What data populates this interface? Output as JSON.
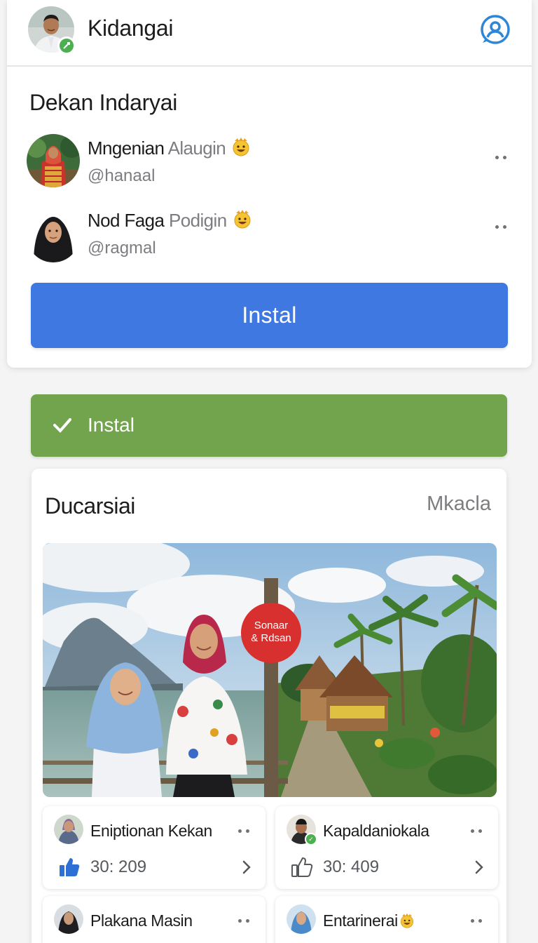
{
  "header": {
    "app_title": "Kidangai",
    "avatar_icon": "user-avatar",
    "status": "online",
    "profile_icon": "profile-search-icon"
  },
  "suggestions": {
    "title": "Dekan Indaryai",
    "people": [
      {
        "name": "Mngenian",
        "name_suffix": "Alaugin",
        "handle": "@hanaal",
        "badge_icon": "smiley-emoji"
      },
      {
        "name": "Nod Faga",
        "name_suffix": "Podigin",
        "handle": "@ragmal",
        "badge_icon": "smiley-emoji"
      }
    ],
    "install_label": "Instal"
  },
  "installed_bar": {
    "label": "Instal",
    "icon": "check-icon"
  },
  "feed": {
    "title": "Ducarsiai",
    "more_label": "Mkacla",
    "photo_sign": [
      "Sonaar",
      "& Rdsan"
    ],
    "cards": [
      {
        "name": "Eniptionan Kekan",
        "count": "30: 209",
        "reaction_icon": "thumbs-up-filled-icon"
      },
      {
        "name": "Kapaldaniokala",
        "count": "30: 409",
        "reaction_icon": "thumbs-up-outline-icon"
      },
      {
        "name": "Plakana Masin",
        "count": "",
        "reaction_icon": ""
      },
      {
        "name": "Entarinerai",
        "count": "",
        "reaction_icon": "",
        "badge_icon": "smiley-emoji"
      }
    ]
  },
  "colors": {
    "primary_blue": "#3f78e0",
    "success_green": "#72a44e",
    "background": "#f3f4f3"
  }
}
